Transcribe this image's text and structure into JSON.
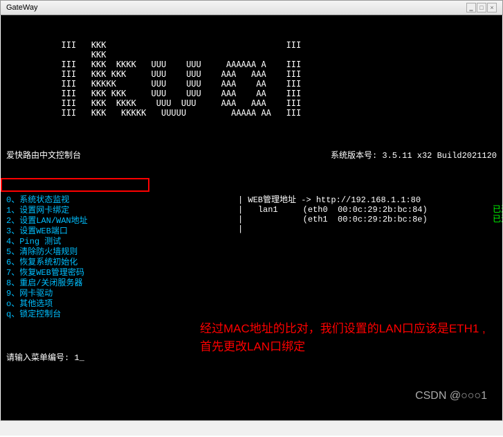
{
  "window": {
    "title": "GateWay"
  },
  "ascii_art": "           III   KKK                                    III\n                 KKK\n           III   KKK  KKKK   UUU    UUU     AAAAAA A    III\n           III   KKK KKK     UUU    UUU    AAA   AAA    III\n           III   KKKKK       UUU    UUU    AAA    AA    III\n           III   KKK KKK     UUU    UUU    AAA    AA    III\n           III   KKK  KKKK    UUU  UUU     AAA   AAA    III\n           III   KKK   KKKKK   UUUUU         AAAAA AA   III",
  "console_title": "爱快路由中文控制台",
  "version_label": "系统版本号: 3.5.11 x32 Build2021120",
  "menu": {
    "items": [
      {
        "key": "0",
        "label": "系统状态监视"
      },
      {
        "key": "1",
        "label": "设置网卡绑定"
      },
      {
        "key": "2",
        "label": "设置LAN/WAN地址"
      },
      {
        "key": "3",
        "label": "设置WEB端口"
      },
      {
        "key": "4",
        "label": "Ping 测试"
      },
      {
        "key": "5",
        "label": "清除防火墙规则"
      },
      {
        "key": "6",
        "label": "恢复系统初始化"
      },
      {
        "key": "7",
        "label": "恢复WEB管理密码"
      },
      {
        "key": "8",
        "label": "重启/关闭服务器"
      },
      {
        "key": "9",
        "label": "网卡驱动"
      },
      {
        "key": "o",
        "label": "其他选项"
      },
      {
        "key": "q",
        "label": "锁定控制台"
      }
    ]
  },
  "web_mgmt": {
    "label": "WEB管理地址 -> ",
    "url": "http://192.168.1.1:80"
  },
  "nics": [
    {
      "name": "lan1",
      "iface": "eth0",
      "mac": "00:0c:29:2b:bc:84",
      "status": "已连"
    },
    {
      "name": "",
      "iface": "eth1",
      "mac": "00:0c:29:2b:bc:8e",
      "status": "已连"
    }
  ],
  "prompt": {
    "label": "请输入菜单编号: ",
    "value": "1_"
  },
  "annotation": "经过MAC地址的比对，我们设置的LAN口应该是ETH1 ,首先更改LAN口绑定",
  "watermark": "CSDN @○○○1"
}
